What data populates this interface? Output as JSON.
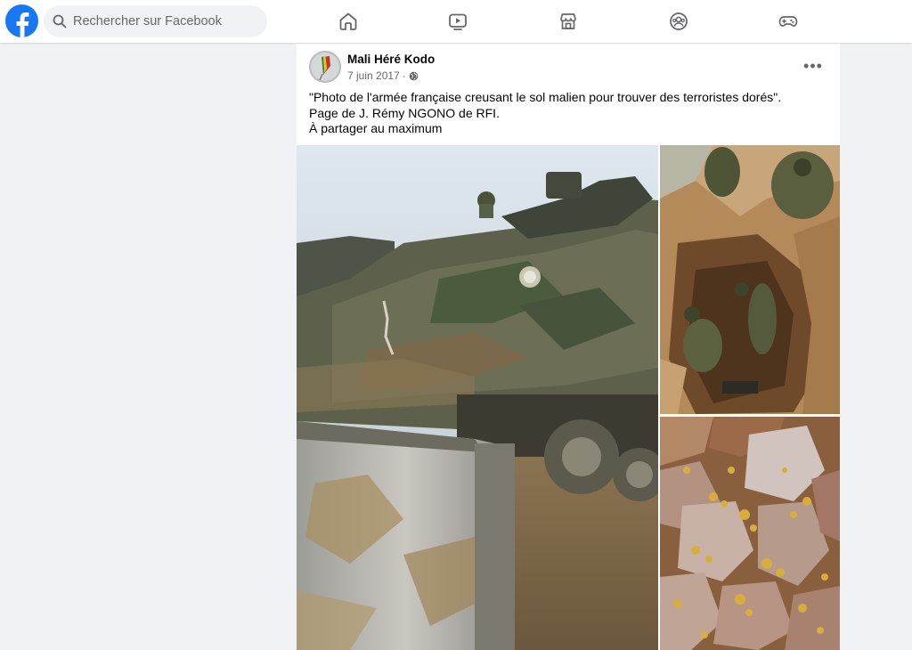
{
  "topbar": {
    "logo_icon": "facebook-logo-icon",
    "brand_color": "#1877f2",
    "search_placeholder": "Rechercher sur Facebook",
    "nav_icons": [
      "home-icon",
      "video-icon",
      "marketplace-icon",
      "groups-icon",
      "gaming-icon"
    ]
  },
  "post": {
    "author": "Mali Héré Kodo",
    "date": "7 juin 2017",
    "separator": "·",
    "audience_icon": "globe-icon",
    "more_label": "•••",
    "text_lines": [
      "\"Photo de l'armée française creusant le sol malien pour trouver des terroristes dorés\".",
      "Page de J. Rémy NGONO de RFI.",
      "À partager au maximum"
    ],
    "photos": [
      {
        "subject": "armored-bulldozer-vehicle"
      },
      {
        "subject": "soldiers-digging-pit"
      },
      {
        "subject": "gold-nuggets-on-rocks"
      }
    ]
  }
}
